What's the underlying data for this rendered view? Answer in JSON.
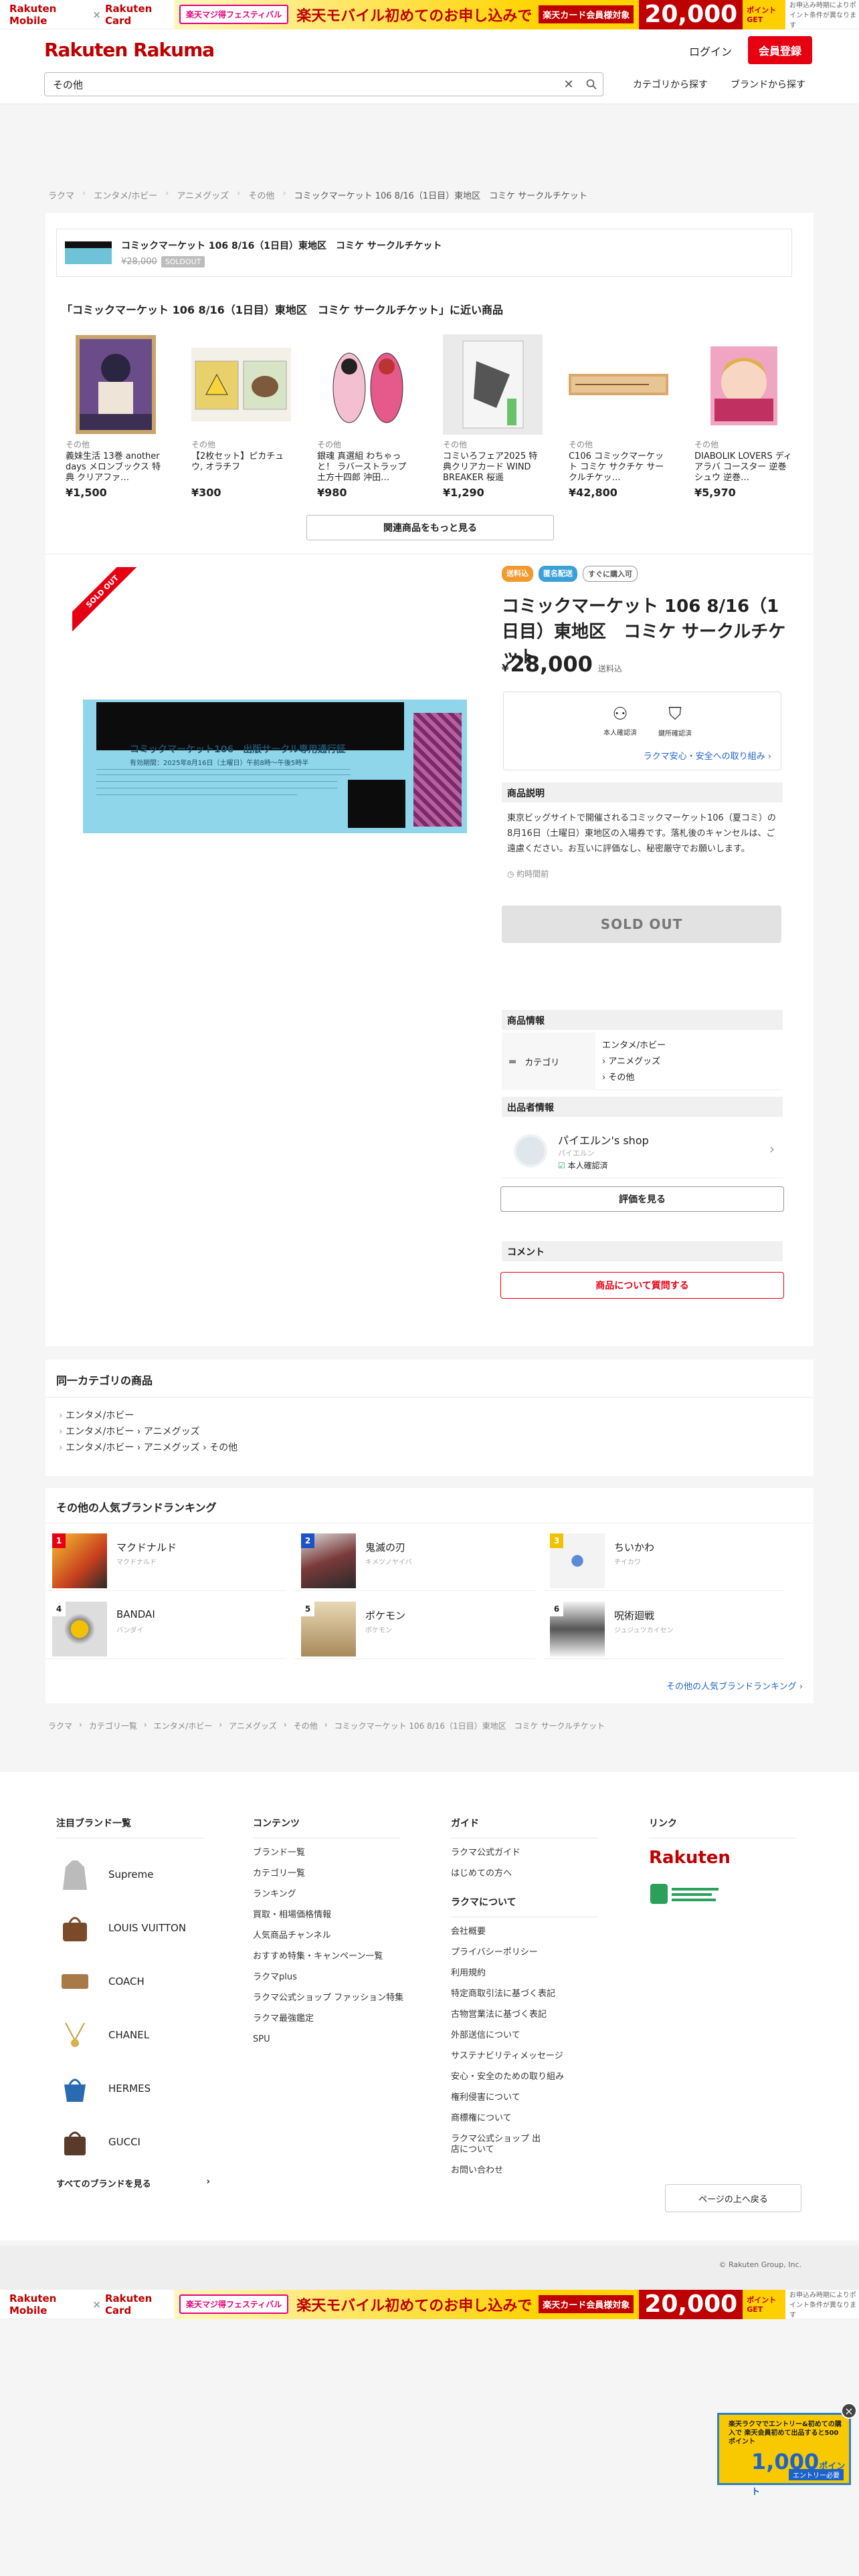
{
  "banner": {
    "rakuten_mobile": "Rakuten Mobile",
    "x": "×",
    "rakuten_card": "Rakuten Card",
    "festival": "楽天マジ得フェスティバル",
    "message": "楽天モバイル初めてのお申し込みで",
    "card_badge": "楽天カード会員様対象",
    "points": "20,000",
    "points_unit": "ポイントGET",
    "note": "お申込み時期によりポイント条件が異なります"
  },
  "header": {
    "logo": "Rakuten Rakuma",
    "login": "ログイン",
    "register": "会員登録",
    "search_value": "その他",
    "category_link": "カテゴリから探す",
    "brand_link": "ブランドから探す"
  },
  "breadcrumb": [
    "ラクマ",
    "エンタメ/ホビー",
    "アニメグッズ",
    "その他",
    "コミックマーケット 106 8/16（1日目）東地区　コミケ サークルチケット"
  ],
  "mini_item": {
    "title": "コミックマーケット 106 8/16（1日目）東地区　コミケ サークルチケット",
    "old_price": "¥28,000",
    "sold": "SOLDOUT"
  },
  "near": {
    "title": "「コミックマーケット 106 8/16（1日目）東地区　コミケ サークルチケット」に近い商品",
    "items": [
      {
        "cat": "その他",
        "name": "義妹生活 13巻 another days メロンブックス 特典 クリアファ…",
        "price": "¥1,500"
      },
      {
        "cat": "その他",
        "name": "【2枚セット】ピカチュウ, オラチフ",
        "price": "¥300"
      },
      {
        "cat": "その他",
        "name": "銀魂 真選組 わちゃっと！ ラバーストラップ 土方十四郎 沖田…",
        "price": "¥980"
      },
      {
        "cat": "その他",
        "name": "コミいろフェア2025 特典クリアカード WIND BREAKER 桜遥",
        "price": "¥1,290"
      },
      {
        "cat": "その他",
        "name": "C106 コミックマーケット コミケ サクチケ サークルチケッ…",
        "price": "¥42,800"
      },
      {
        "cat": "その他",
        "name": "DIABOLIK LOVERS ディアラバ コースター 逆巻シュウ 逆巻…",
        "price": "¥5,970"
      }
    ],
    "more": "関連商品をもっと見る"
  },
  "product": {
    "soldout_ribbon": "SOLD OUT",
    "tags": [
      "送料込",
      "匿名配送",
      "すぐに購入可"
    ],
    "title": "コミックマーケット 106 8/16（1日目）東地区　コミケ サークルチケット",
    "price_yen": "¥",
    "price": "28,000",
    "shipping": "送料込",
    "safe_icon1": "本人確認済",
    "safe_icon2": "鍵所確認済",
    "safe_link": "ラクマ安心・安全への取り組み",
    "desc_heading": "商品説明",
    "description": "東京ビッグサイトで開催されるコミックマーケット106（夏コミ）の8月16日（土曜日）東地区の入場券です。落札後のキャンセルは、ご遠慮ください。お互いに評価なし、秘密厳守でお願いします。",
    "ago": "約時間前",
    "sold_button": "SOLD OUT",
    "info_heading": "商品情報",
    "category_label": "カテゴリ",
    "category_values": [
      "エンタメ/ホビー",
      "› アニメグッズ",
      "› その他"
    ],
    "seller_heading": "出品者情報",
    "seller_name": "パイエルン's shop",
    "seller_kana": "パイエルン",
    "seller_verified": "本人確認済",
    "review_button": "評価を見る",
    "comment_heading": "コメント",
    "ask_button": "商品について質問する",
    "ticket_title": "コミックマーケット106　出版サークル専用通行証",
    "ticket_date": "有効期間：2025年8月16日（土曜日）午前8時〜午後5時半"
  },
  "same_category": {
    "title": "同一カテゴリの商品",
    "items": [
      "エンタメ/ホビー",
      "エンタメ/ホビー › アニメグッズ",
      "エンタメ/ホビー › アニメグッズ › その他"
    ]
  },
  "ranking": {
    "title": "その他の人気ブランドランキング",
    "items": [
      {
        "n": "1",
        "name": "マクドナルド",
        "kana": "マクドナルド",
        "color": "#e60012"
      },
      {
        "n": "2",
        "name": "鬼滅の刃",
        "kana": "キメツノヤイバ",
        "color": "#1e50c8"
      },
      {
        "n": "3",
        "name": "ちいかわ",
        "kana": "チイカワ",
        "color": "#f2c200"
      },
      {
        "n": "4",
        "name": "BANDAI",
        "kana": "バンダイ",
        "color": "#ffffff"
      },
      {
        "n": "5",
        "name": "ポケモン",
        "kana": "ポケモン",
        "color": "#ffffff"
      },
      {
        "n": "6",
        "name": "呪術廻戦",
        "kana": "ジュジュツカイセン",
        "color": "#ffffff"
      }
    ],
    "more": "その他の人気ブランドランキング"
  },
  "breadcrumb2": [
    "ラクマ",
    "カテゴリ一覧",
    "エンタメ/ホビー",
    "アニメグッズ",
    "その他",
    "コミックマーケット 106 8/16（1日目）東地区　コミケ サークルチケット"
  ],
  "footer": {
    "brands_title": "注目ブランド一覧",
    "brands": [
      "Supreme",
      "LOUIS VUITTON",
      "COACH",
      "CHANEL",
      "HERMES",
      "GUCCI"
    ],
    "all_brands": "すべてのブランドを見る",
    "contents_title": "コンテンツ",
    "contents": [
      "ブランド一覧",
      "カテゴリ一覧",
      "ランキング",
      "買取・相場価格情報",
      "人気商品チャンネル",
      "おすすめ特集・キャンペーン一覧",
      "ラクマplus",
      "ラクマ公式ショップ ファッション特集",
      "ラクマ最強鑑定",
      "SPU"
    ],
    "guide_title": "ガイド",
    "guide": [
      "ラクマ公式ガイド",
      "はじめての方へ"
    ],
    "about_title": "ラクマについて",
    "about": [
      "会社概要",
      "プライバシーポリシー",
      "利用規約",
      "特定商取引法に基づく表記",
      "古物営業法に基づく表記",
      "外部送信について",
      "サステナビリティメッセージ",
      "安心・安全のための取り組み",
      "権利侵害について",
      "商標権について",
      "ラクマ公式ショップ 出店について",
      "お問い合わせ"
    ],
    "links_title": "リンク",
    "rakuten": "Rakuten",
    "top_button": "ページの上へ戻る",
    "copyright": "© Rakuten Group, Inc."
  },
  "popup": {
    "text": "楽天ラクマでエントリー&初めての購入で 楽天会員初めて出品すると500ポイント",
    "big": "1,000",
    "unit": "ポイント",
    "entry": "エントリー必要",
    "close": "×"
  }
}
